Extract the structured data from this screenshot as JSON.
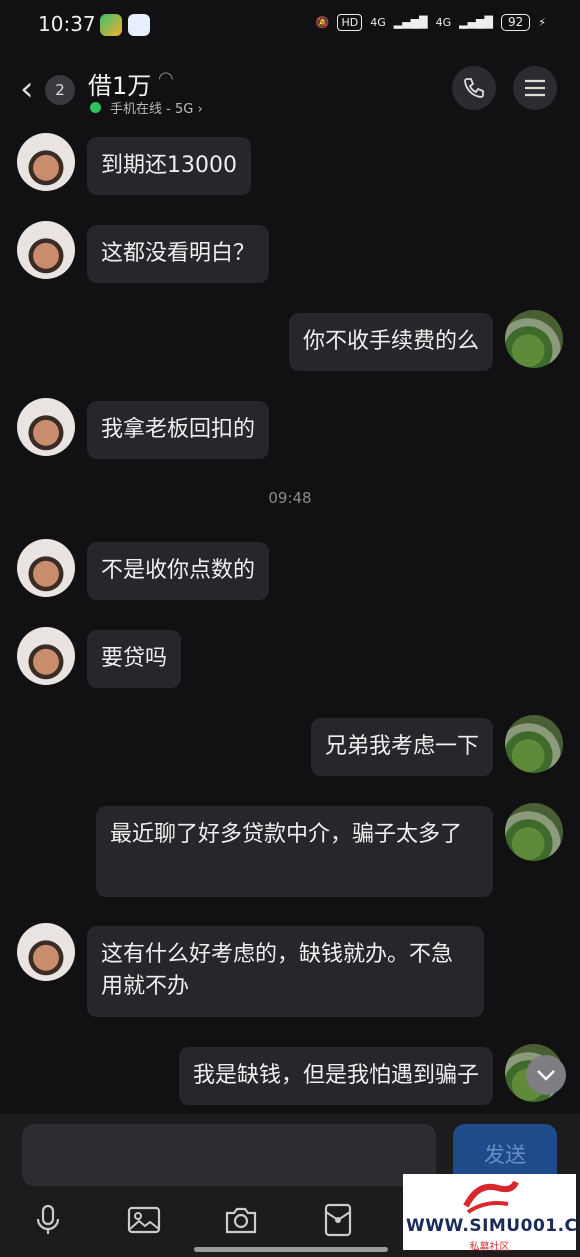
{
  "status": {
    "time": "10:37",
    "hd": "HD",
    "net1": "4G",
    "net2": "4G",
    "battery": "92"
  },
  "header": {
    "back_count": "2",
    "title": "借1万",
    "online": "手机在线 - 5G",
    "online_chevron": "›"
  },
  "timestamp": "09:48",
  "messages": [
    {
      "side": "left",
      "text": "到期还13000"
    },
    {
      "side": "left",
      "text": "这都没看明白？"
    },
    {
      "side": "right",
      "text": "你不收手续费的么"
    },
    {
      "side": "left",
      "text": "我拿老板回扣的"
    },
    {
      "side": "left",
      "text": "不是收你点数的"
    },
    {
      "side": "left",
      "text": "要贷吗"
    },
    {
      "side": "right",
      "text": "兄弟我考虑一下"
    },
    {
      "side": "right",
      "text": "最近聊了好多贷款中介，骗子太多了"
    },
    {
      "side": "left",
      "text": "这有什么好考虑的，缺钱就办。不急用就不办"
    },
    {
      "side": "right",
      "text": "我是缺钱，但是我怕遇到骗子"
    }
  ],
  "input": {
    "send_label": "发送"
  },
  "watermark": {
    "text": "WWW.SIMU001.CN",
    "sub": "私募社区"
  },
  "colors": {
    "online": "#2ec45b",
    "send": "#1e4b8a",
    "bubble": "#26262b"
  }
}
